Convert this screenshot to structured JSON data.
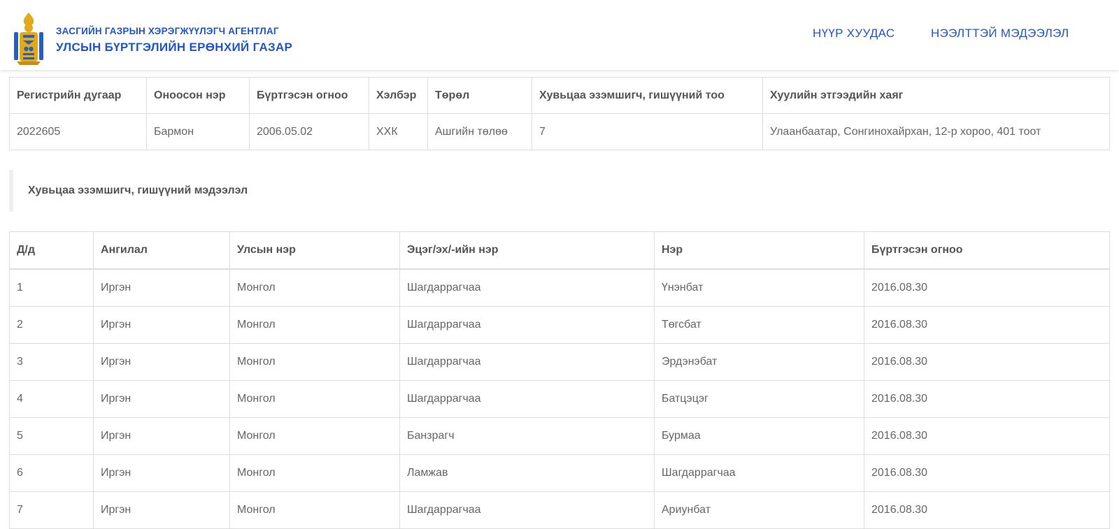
{
  "header": {
    "org_line1": "ЗАСГИЙН ГАЗРЫН ХЭРЭГЖҮҮЛЭГЧ АГЕНТЛАГ",
    "org_line2": "УЛСЫН БҮРТГЭЛИЙН ЕРӨНХИЙ ГАЗАР",
    "nav_home": "НҮҮР ХУУДАС",
    "nav_info": "НЭЭЛТТЭЙ МЭДЭЭЛЭЛ",
    "logo_icon": "soyombo-emblem-icon"
  },
  "colors": {
    "accent": "#1f57c8",
    "border": "#dddddd",
    "text": "#555555"
  },
  "company": {
    "headers": [
      "Регистрийн дугаар",
      "Оноосон нэр",
      "Бүртгэсэн огноо",
      "Хэлбэр",
      "Төрөл",
      "Хувьцаа эзэмшигч, гишүүний тоо",
      "Хуулийн этгээдийн хаяг"
    ],
    "row": [
      "2022605",
      "Бармон",
      "2006.05.02",
      "ХХК",
      "Ашгийн төлөө",
      "7",
      "Улаанбаатар, Сонгинохайрхан, 12-р хороо, 401 тоот"
    ]
  },
  "section": {
    "title": "Хувьцаа эзэмшигч, гишүүний мэдээлэл"
  },
  "members": {
    "headers": [
      "Д/д",
      "Ангилал",
      "Улсын нэр",
      "Эцэг/эх/-ийн нэр",
      "Нэр",
      "Бүртгэсэн огноо"
    ],
    "rows": [
      [
        "1",
        "Иргэн",
        "Монгол",
        "Шагдаррагчаа",
        "Үнэнбат",
        "2016.08.30"
      ],
      [
        "2",
        "Иргэн",
        "Монгол",
        "Шагдаррагчаа",
        "Төгсбат",
        "2016.08.30"
      ],
      [
        "3",
        "Иргэн",
        "Монгол",
        "Шагдаррагчаа",
        "Эрдэнэбат",
        "2016.08.30"
      ],
      [
        "4",
        "Иргэн",
        "Монгол",
        "Шагдаррагчаа",
        "Батцэцэг",
        "2016.08.30"
      ],
      [
        "5",
        "Иргэн",
        "Монгол",
        "Банзрагч",
        "Бурмаа",
        "2016.08.30"
      ],
      [
        "6",
        "Иргэн",
        "Монгол",
        "Ламжав",
        "Шагдаррагчаа",
        "2016.08.30"
      ],
      [
        "7",
        "Иргэн",
        "Монгол",
        "Шагдаррагчаа",
        "Ариунбат",
        "2016.08.30"
      ]
    ]
  }
}
